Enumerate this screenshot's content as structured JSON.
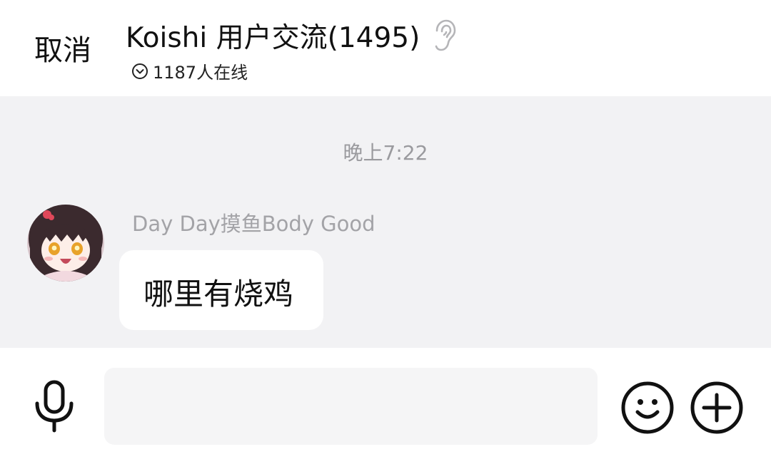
{
  "header": {
    "cancel_label": "取消",
    "title": "Koishi 用户交流(1495)",
    "online_text": "1187人在线",
    "listen_icon": "ear-icon",
    "online_icon": "chevron-down-circle-icon"
  },
  "chat": {
    "timestamp": "晚上7:22",
    "messages": [
      {
        "sender": "Day Day摸鱼Body Good",
        "text": "哪里有烧鸡",
        "avatar": "anime-girl-avatar"
      }
    ]
  },
  "input_bar": {
    "voice_icon": "microphone-icon",
    "placeholder": "",
    "value": "",
    "emoji_icon": "smiley-icon",
    "more_icon": "plus-circle-icon"
  },
  "colors": {
    "chat_background": "#f2f2f4",
    "bubble": "#ffffff",
    "muted_text": "#a3a3a7"
  }
}
